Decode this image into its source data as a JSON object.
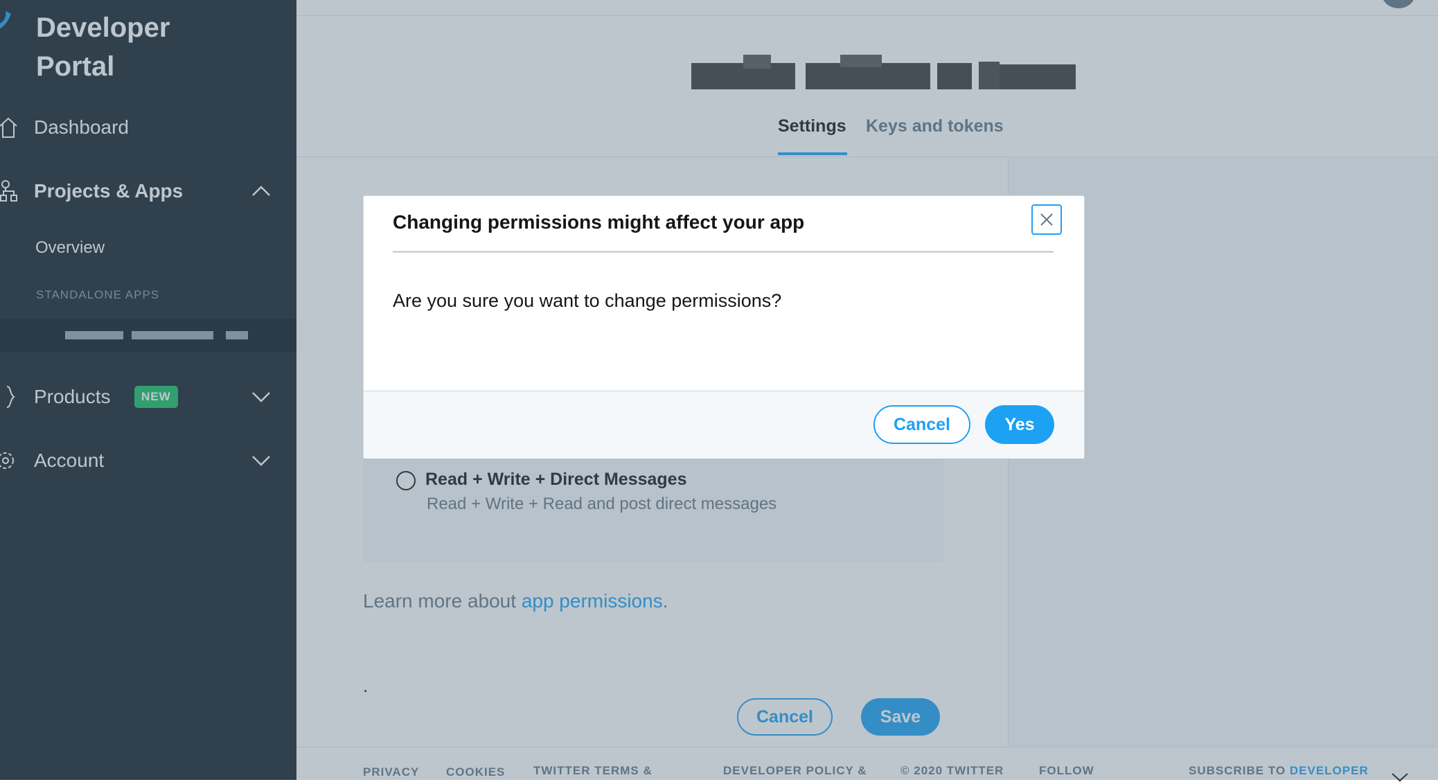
{
  "colors": {
    "sidebar_bg": "#15202b",
    "accent": "#1da1f2",
    "badge": "#17bf63",
    "overlay": "rgba(91,112,131,0.4)"
  },
  "sidebar": {
    "brand_title": "Developer\nPortal",
    "nav": {
      "dashboard": {
        "label": "Dashboard",
        "icon": "home-icon"
      },
      "projects_apps": {
        "label": "Projects & Apps",
        "icon": "apps-icon",
        "expanded": true
      },
      "overview": {
        "label": "Overview"
      },
      "standalone_label": "STANDALONE APPS",
      "products": {
        "label": "Products",
        "badge": "NEW",
        "icon": "brackets-icon"
      },
      "account": {
        "label": "Account",
        "icon": "gear-icon"
      }
    }
  },
  "main": {
    "tabs": [
      {
        "label": "Settings",
        "active": true
      },
      {
        "label": "Keys and tokens",
        "active": false
      }
    ],
    "permission_option": {
      "title": "Read + Write + Direct Messages",
      "description": "Read + Write + Read and post direct messages",
      "selected": false
    },
    "learn_more": {
      "prefix": "Learn more about ",
      "link": "app permissions",
      "suffix": "."
    },
    "dot": ".",
    "cancel_label": "Cancel",
    "save_label": "Save"
  },
  "footer": {
    "items": [
      "PRIVACY",
      "COOKIES",
      "TWITTER TERMS &",
      "DEVELOPER POLICY &",
      "© 2020 TWITTER",
      "FOLLOW"
    ],
    "subscribe_prefix": "SUBSCRIBE TO ",
    "subscribe_link": "DEVELOPER"
  },
  "modal": {
    "title": "Changing permissions might affect your app",
    "body": "Are you sure you want to change permissions?",
    "cancel_label": "Cancel",
    "yes_label": "Yes"
  }
}
